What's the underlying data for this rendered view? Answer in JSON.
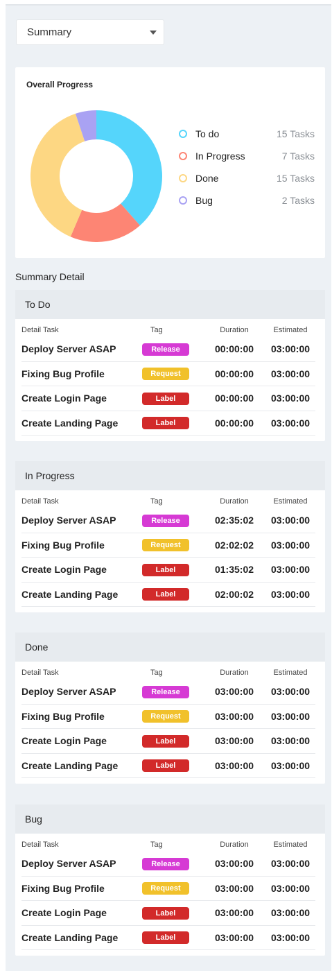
{
  "view_select": {
    "value": "Summary"
  },
  "overall": {
    "title": "Overall Progress",
    "legend": [
      {
        "label": "To do",
        "count": "15 Tasks",
        "color": "#55d5fb",
        "value": 15
      },
      {
        "label": "In Progress",
        "count": "7 Tasks",
        "color": "#fd8574",
        "value": 7
      },
      {
        "label": "Done",
        "count": "15 Tasks",
        "color": "#fdd783",
        "value": 15
      },
      {
        "label": "Bug",
        "count": "2 Tasks",
        "color": "#a9a2f3",
        "value": 2
      }
    ]
  },
  "chart_data": {
    "type": "pie",
    "categories": [
      "To do",
      "In Progress",
      "Done",
      "Bug"
    ],
    "values": [
      15,
      7,
      15,
      2
    ],
    "title": "Overall Progress",
    "colors": [
      "#55d5fb",
      "#fd8574",
      "#fdd783",
      "#a9a2f3"
    ],
    "legend": "right"
  },
  "summary_heading": "Summary Detail",
  "columns": {
    "task": "Detail Task",
    "tag": "Tag",
    "duration": "Duration",
    "estimated": "Estimated"
  },
  "groups": [
    {
      "title": "To Do",
      "rows": [
        {
          "task": "Deploy Server ASAP",
          "tag": "Release",
          "tag_type": "release",
          "duration": "00:00:00",
          "estimated": "03:00:00"
        },
        {
          "task": "Fixing Bug Profile",
          "tag": "Request",
          "tag_type": "request",
          "duration": "00:00:00",
          "estimated": "03:00:00"
        },
        {
          "task": "Create Login Page",
          "tag": "Label",
          "tag_type": "label",
          "duration": "00:00:00",
          "estimated": "03:00:00"
        },
        {
          "task": "Create Landing Page",
          "tag": "Label",
          "tag_type": "label",
          "duration": "00:00:00",
          "estimated": "03:00:00"
        }
      ]
    },
    {
      "title": "In Progress",
      "rows": [
        {
          "task": "Deploy Server ASAP",
          "tag": "Release",
          "tag_type": "release",
          "duration": "02:35:02",
          "estimated": "03:00:00"
        },
        {
          "task": "Fixing Bug Profile",
          "tag": "Request",
          "tag_type": "request",
          "duration": "02:02:02",
          "estimated": "03:00:00"
        },
        {
          "task": "Create Login Page",
          "tag": "Label",
          "tag_type": "label",
          "duration": "01:35:02",
          "estimated": "03:00:00"
        },
        {
          "task": "Create Landing Page",
          "tag": "Label",
          "tag_type": "label",
          "duration": "02:00:02",
          "estimated": "03:00:00"
        }
      ]
    },
    {
      "title": "Done",
      "rows": [
        {
          "task": "Deploy Server ASAP",
          "tag": "Release",
          "tag_type": "release",
          "duration": "03:00:00",
          "estimated": "03:00:00"
        },
        {
          "task": "Fixing Bug Profile",
          "tag": "Request",
          "tag_type": "request",
          "duration": "03:00:00",
          "estimated": "03:00:00"
        },
        {
          "task": "Create Login Page",
          "tag": "Label",
          "tag_type": "label",
          "duration": "03:00:00",
          "estimated": "03:00:00"
        },
        {
          "task": "Create Landing Page",
          "tag": "Label",
          "tag_type": "label",
          "duration": "03:00:00",
          "estimated": "03:00:00"
        }
      ]
    },
    {
      "title": "Bug",
      "rows": [
        {
          "task": "Deploy Server ASAP",
          "tag": "Release",
          "tag_type": "release",
          "duration": "03:00:00",
          "estimated": "03:00:00"
        },
        {
          "task": "Fixing Bug Profile",
          "tag": "Request",
          "tag_type": "request",
          "duration": "03:00:00",
          "estimated": "03:00:00"
        },
        {
          "task": "Create Login Page",
          "tag": "Label",
          "tag_type": "label",
          "duration": "03:00:00",
          "estimated": "03:00:00"
        },
        {
          "task": "Create Landing Page",
          "tag": "Label",
          "tag_type": "label",
          "duration": "03:00:00",
          "estimated": "03:00:00"
        }
      ]
    }
  ]
}
